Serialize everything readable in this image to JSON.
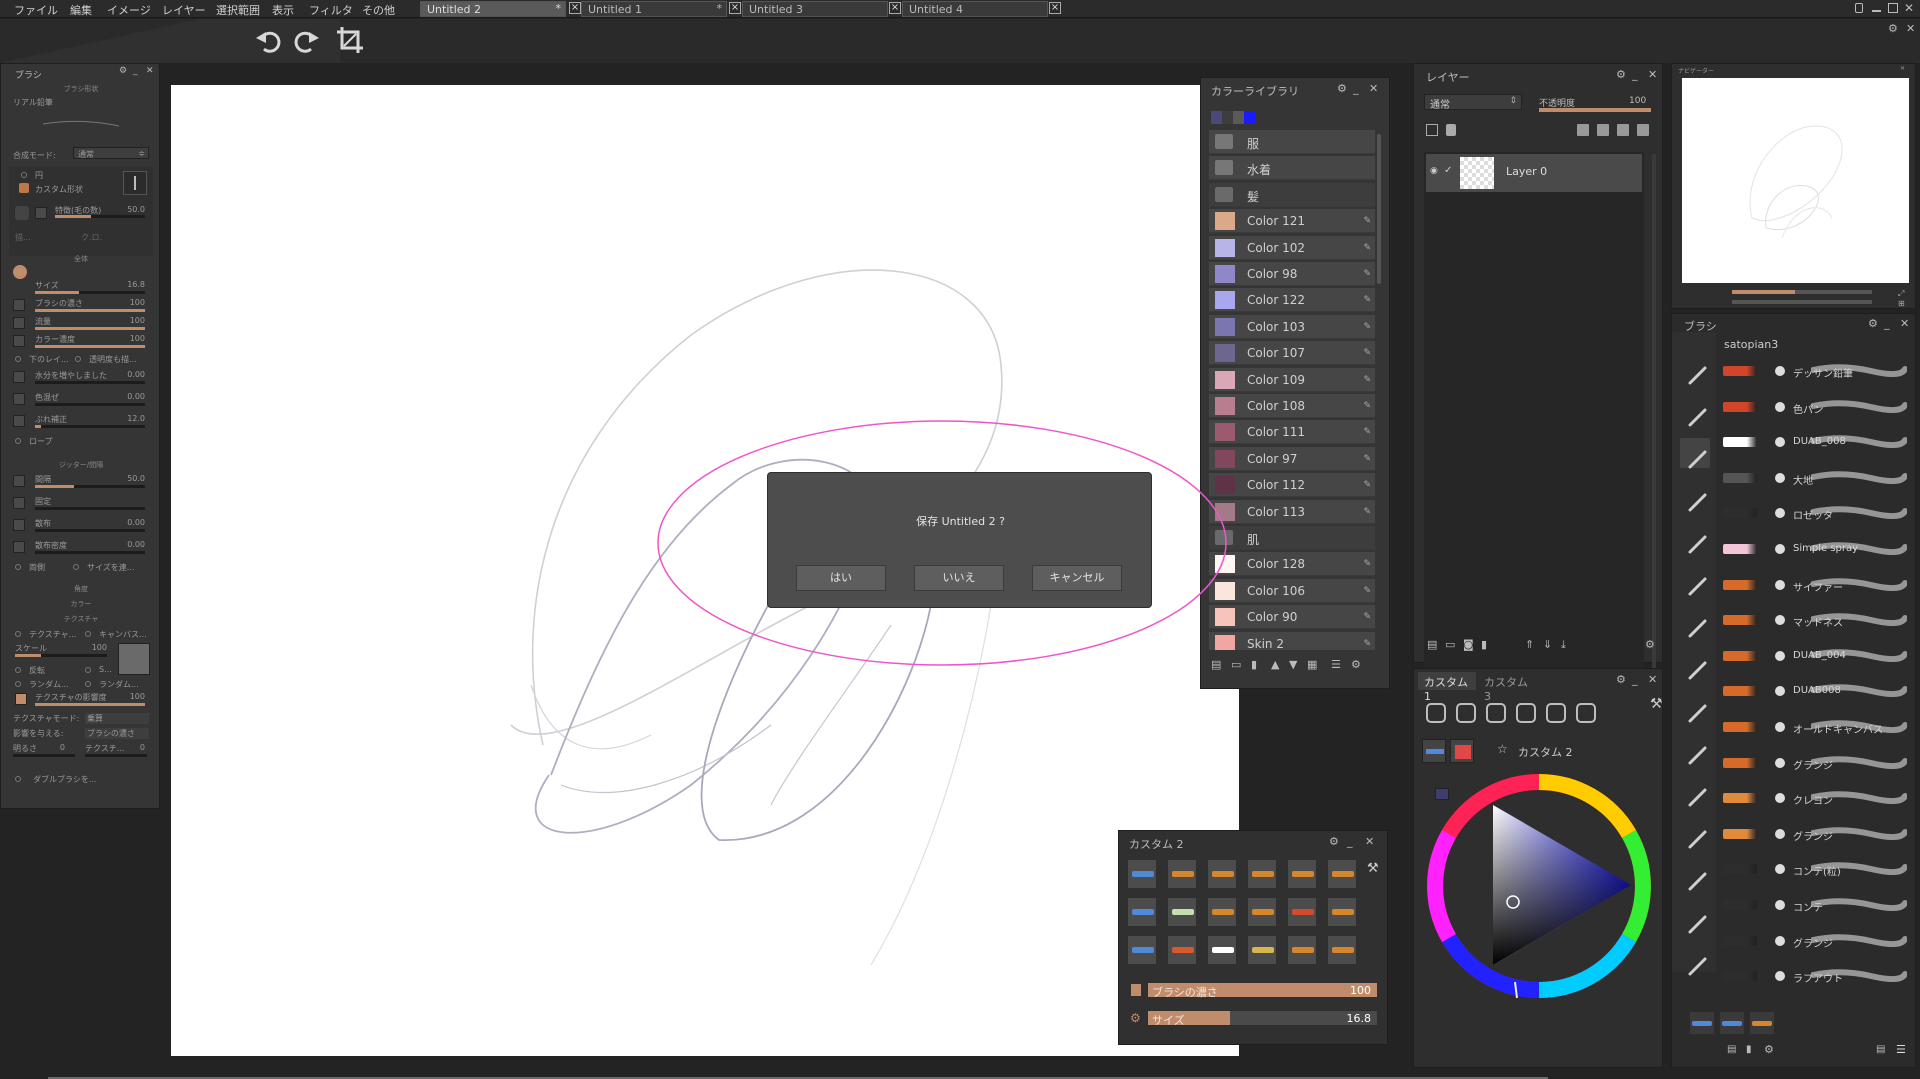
{
  "menubar": {
    "items": [
      "ファイル",
      "編集",
      "イメージ",
      "レイヤー",
      "選択範囲",
      "表示",
      "フィルタ",
      "その他"
    ]
  },
  "tabs": [
    {
      "label": "Untitled 2",
      "modified": "*"
    },
    {
      "label": "Untitled 1",
      "modified": "*"
    },
    {
      "label": "Untitled 3",
      "modified": ""
    },
    {
      "label": "Untitled 4",
      "modified": ""
    }
  ],
  "brush_panel": {
    "title": "ブラシ",
    "shape_section": "ブラシ形状",
    "brush_name": "リアル鉛筆",
    "blend_mode_label": "合成モード:",
    "blend_mode_value": "通常",
    "circle_label": "円",
    "custom_shape_label": "カスタム形状",
    "special_label": "特徴(毛の数)",
    "special_value": "50.0",
    "mini_label_1": "描...",
    "mini_label_2": "ク.ロ.",
    "section_overall": "全体",
    "sliders": [
      {
        "label": "サイズ",
        "value": "16.8",
        "fill": 0.4
      },
      {
        "label": "ブラシの濃さ",
        "value": "100",
        "fill": 1.0
      },
      {
        "label": "流量",
        "value": "100",
        "fill": 1.0
      },
      {
        "label": "カラー濃度",
        "value": "100",
        "fill": 1.0
      }
    ],
    "layer_below_label": "下のレイ...",
    "opacity_lock_label": "透明度も描...",
    "sliders2": [
      {
        "label": "水分を増やしました",
        "value": "0.00",
        "fill": 0.0
      },
      {
        "label": "色混ぜ",
        "value": "0.00",
        "fill": 0.0
      },
      {
        "label": "ぶれ補正",
        "value": "12.0",
        "fill": 0.05
      }
    ],
    "rope_label": "ロープ",
    "section_jitter": "ジッター/間隔",
    "sliders3": [
      {
        "label": "間隔",
        "value": "50.0",
        "fill": 0.35
      },
      {
        "label": "固定",
        "value": "",
        "fill": 0.0
      },
      {
        "label": "散布",
        "value": "0.00",
        "fill": 0.0
      },
      {
        "label": "散布密度",
        "value": "0.00",
        "fill": 0.0
      }
    ],
    "both_sides_label": "両側",
    "size_label": "サイズを連...",
    "section_angle": "角度",
    "section_color": "カラー",
    "section_texture": "テクスチャ",
    "texture_label": "テクスチャ...",
    "canvas_label": "キャンバス...",
    "scale_label": "スケール",
    "scale_value": "100",
    "invert_label": "反転",
    "random_label_1": "ランダム...",
    "random_label_2": "ランダム...",
    "s_label": "S...",
    "texture_strength_label": "テクスチャの影響度",
    "texture_strength_value": "100",
    "texture_mode_label": "テクスチャモード:",
    "texture_mode_value": "乗算",
    "affect_label": "影響を与える:",
    "affect_value": "ブラシの濃さ",
    "brightness_label": "明るさ",
    "brightness_value": "0",
    "texture2_label": "テクスチ...",
    "texture2_value": "0",
    "dual_brush_label": "ダブルブラシを..."
  },
  "dialog": {
    "message": "保存 Untitled 2 ?",
    "yes": "はい",
    "no": "いいえ",
    "cancel": "キャンセル"
  },
  "color_library": {
    "title": "カラーライブラリ",
    "rows": [
      {
        "kind": "folder",
        "name": "服"
      },
      {
        "kind": "folder",
        "name": "水着"
      },
      {
        "kind": "folder",
        "name": "髪",
        "open": true
      },
      {
        "kind": "color",
        "name": "Color 121",
        "color": "#d9a98a"
      },
      {
        "kind": "color",
        "name": "Color 102",
        "color": "#b8b4e8"
      },
      {
        "kind": "color",
        "name": "Color 98",
        "color": "#8e87c8"
      },
      {
        "kind": "color",
        "name": "Color 122",
        "color": "#a9a7ee"
      },
      {
        "kind": "color",
        "name": "Color 103",
        "color": "#7b76b0"
      },
      {
        "kind": "color",
        "name": "Color 107",
        "color": "#6d6790"
      },
      {
        "kind": "color",
        "name": "Color 109",
        "color": "#d9a7b6"
      },
      {
        "kind": "color",
        "name": "Color 108",
        "color": "#b87d8f"
      },
      {
        "kind": "color",
        "name": "Color 111",
        "color": "#9b5a6e"
      },
      {
        "kind": "color",
        "name": "Color 97",
        "color": "#83475d"
      },
      {
        "kind": "color",
        "name": "Color 112",
        "color": "#5e3347"
      },
      {
        "kind": "color",
        "name": "Color 113",
        "color": "#a47a87"
      },
      {
        "kind": "folder",
        "name": "肌",
        "open": true
      },
      {
        "kind": "color",
        "name": "Color 128",
        "color": "#fdf6f2"
      },
      {
        "kind": "color",
        "name": "Color 106",
        "color": "#fbe6dd"
      },
      {
        "kind": "color",
        "name": "Color 90",
        "color": "#f7c4bb"
      },
      {
        "kind": "color",
        "name": "Skin 2",
        "color": "#f0a6a2"
      }
    ],
    "top_swatches": [
      "#4a4a7a",
      "#3d3d3d",
      "#5a5a5a",
      "#1b1bff"
    ]
  },
  "layers": {
    "title": "レイヤー",
    "blend_mode": "通常",
    "opacity_label": "不透明度",
    "opacity_value": "100",
    "opacity_fraction": 1.0,
    "layer_name": "Layer 0"
  },
  "navigator": {
    "title": "ナビゲーター"
  },
  "brushes": {
    "title": "ブラシ",
    "set_name": "satopian3",
    "items": [
      {
        "name": "デッサン鉛筆",
        "tip": "#d1452a"
      },
      {
        "name": "色パン",
        "tip": "#d1452a"
      },
      {
        "name": "DUAB_008",
        "tip": "#ffffff"
      },
      {
        "name": "大地",
        "tip": "#555555"
      },
      {
        "name": "ロゼッタ",
        "tip": "#2d2d2d"
      },
      {
        "name": "Simple spray",
        "tip": "#f2c6d8"
      },
      {
        "name": "サイファー",
        "tip": "#d66a2b"
      },
      {
        "name": "マッドネス",
        "tip": "#d66a2b"
      },
      {
        "name": "DUAB_004",
        "tip": "#d66a2b"
      },
      {
        "name": "DUAB008",
        "tip": "#d66a2b"
      },
      {
        "name": "オールドキャンバス",
        "tip": "#d66a2b"
      },
      {
        "name": "グランジ",
        "tip": "#d66a2b"
      },
      {
        "name": "クレヨン",
        "tip": "#e08a3c"
      },
      {
        "name": "グランジ",
        "tip": "#e08a3c"
      },
      {
        "name": "コンテ(粒)",
        "tip": "#2d2d2d"
      },
      {
        "name": "コンテ",
        "tip": "#2d2d2d"
      },
      {
        "name": "グランジ",
        "tip": "#2d2d2d"
      },
      {
        "name": "ラフアウト",
        "tip": "#2d2d2d"
      }
    ]
  },
  "custom_panel": {
    "tab1": "カスタム 1",
    "tab2": "カスタム 3",
    "custom_label": "カスタム 2"
  },
  "custom2": {
    "title": "カスタム 2",
    "density_label": "ブラシの濃さ",
    "density_value": "100",
    "density_fraction": 1.0,
    "size_label": "サイズ",
    "size_value": "16.8",
    "size_fraction": 0.36
  },
  "colors": {
    "accent": "#c08c6c",
    "canvas": "#ffffff",
    "highlight_ellipse": "#ee55cc",
    "current_color": "#3f3d6e"
  }
}
